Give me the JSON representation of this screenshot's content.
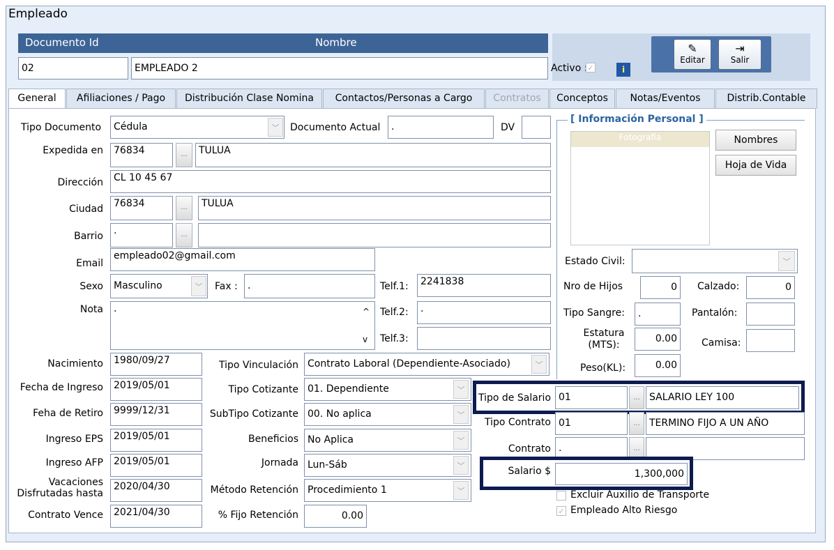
{
  "window": {
    "title": "Empleado"
  },
  "header": {
    "doc_id_label": "Documento Id",
    "name_label": "Nombre",
    "doc_id_value": "02",
    "name_value": "EMPLEADO 2",
    "activo_label": "Activo :",
    "activo_checked": "✓",
    "info_icon": "i"
  },
  "toolbar": {
    "edit_label": "Editar",
    "exit_label": "Salir"
  },
  "tabs": [
    {
      "label": "General"
    },
    {
      "label": "Afiliaciones / Pago"
    },
    {
      "label": "Distribución Clase Nomina"
    },
    {
      "label": "Contactos/Personas a Cargo"
    },
    {
      "label": "Contratos"
    },
    {
      "label": "Conceptos"
    },
    {
      "label": "Notas/Eventos"
    },
    {
      "label": "Distrib.Contable"
    }
  ],
  "general": {
    "tipo_documento_label": "Tipo Documento",
    "tipo_documento_value": "Cédula",
    "documento_actual_label": "Documento Actual",
    "documento_actual_value": ".",
    "dv_label": "DV",
    "dv_value": "",
    "expedida_label": "Expedida en",
    "expedida_code": "76834",
    "expedida_city": "TULUA",
    "direccion_label": "Dirección",
    "direccion_value": "CL 10 45 67",
    "ciudad_label": "Ciudad",
    "ciudad_code": "76834",
    "ciudad_name": "TULUA",
    "barrio_label": "Barrio",
    "barrio_code": ".",
    "barrio_name": "",
    "email_label": "Email",
    "email_value": "empleado02@gmail.com",
    "sexo_label": "Sexo",
    "sexo_value": "Masculino",
    "fax_label": "Fax :",
    "fax_value": ".",
    "telf1_label": "Telf.1:",
    "telf1_value": "2241838",
    "nota_label": "Nota",
    "nota_value": ".",
    "telf2_label": "Telf.2:",
    "telf2_value": ".",
    "telf3_label": "Telf.3:",
    "telf3_value": "",
    "nacimiento_label": "Nacimiento",
    "nacimiento_value": "1980/09/27",
    "fecha_ingreso_label": "Fecha de Ingreso",
    "fecha_ingreso_value": "2019/05/01",
    "fecha_retiro_label": "Feha de Retiro",
    "fecha_retiro_value": "9999/12/31",
    "ingreso_eps_label": "Ingreso EPS",
    "ingreso_eps_value": "2019/05/01",
    "ingreso_afp_label": "Ingreso AFP",
    "ingreso_afp_value": "2019/05/01",
    "vacaciones_label_1": "Vacaciones",
    "vacaciones_label_2": "Disfrutadas hasta",
    "vacaciones_value": "2020/04/30",
    "contrato_vence_label": "Contrato Vence",
    "contrato_vence_value": "2021/04/30",
    "tipo_vinculacion_label": "Tipo Vinculación",
    "tipo_vinculacion_value": "Contrato Laboral (Dependiente-Asociado)",
    "tipo_cotizante_label": "Tipo Cotizante",
    "tipo_cotizante_value": "01. Dependiente",
    "subtipo_cotizante_label": "SubTipo Cotizante",
    "subtipo_cotizante_value": "00. No aplica",
    "beneficios_label": "Beneficios",
    "beneficios_value": "No Aplica",
    "jornada_label": "Jornada",
    "jornada_value": "Lun-Sáb",
    "metodo_retencion_label": "Método Retención",
    "metodo_retencion_value": "Procedimiento 1",
    "fijo_retencion_label": "% Fijo Retención",
    "fijo_retencion_value": "0.00",
    "tipo_salario_label": "Tipo de Salario",
    "tipo_salario_code": "01",
    "tipo_salario_name": "SALARIO LEY 100",
    "tipo_contrato_label": "Tipo Contrato",
    "tipo_contrato_code": "01",
    "tipo_contrato_name": "TERMINO FIJO A UN AÑO",
    "contrato_label": "Contrato",
    "contrato_code": ".",
    "contrato_name": "",
    "salario_label": "Salario $",
    "salario_value": "1,300,000",
    "excluir_auxilio_label": "Excluir Auxilio de Transporte",
    "alto_riesgo_label": "Empleado Alto Riesgo",
    "alto_riesgo_checked": "✓"
  },
  "personal": {
    "title": "[ Información Personal ]",
    "fotografia_label": "Fotografia",
    "nombres_button": "Nombres",
    "hoja_vida_button": "Hoja de Vida",
    "estado_civil_label": "Estado Civil:",
    "estado_civil_value": "",
    "nro_hijos_label": "Nro de Hijos",
    "nro_hijos_value": "0",
    "calzado_label": "Calzado:",
    "calzado_value": "0",
    "tipo_sangre_label": "Tipo Sangre:",
    "tipo_sangre_value": ".",
    "pantalon_label": "Pantalón:",
    "pantalon_value": "",
    "estatura_label_1": "Estatura",
    "estatura_label_2": "(MTS):",
    "estatura_value": "0.00",
    "camisa_label": "Camisa:",
    "camisa_value": "",
    "peso_label": "Peso(KL):",
    "peso_value": "0.00"
  },
  "icons": {
    "ellipsis": "...",
    "dropdown": "﹀",
    "scroll_up": "^",
    "scroll_down": "v",
    "edit_icon": "✎",
    "exit_icon": "⇥"
  }
}
